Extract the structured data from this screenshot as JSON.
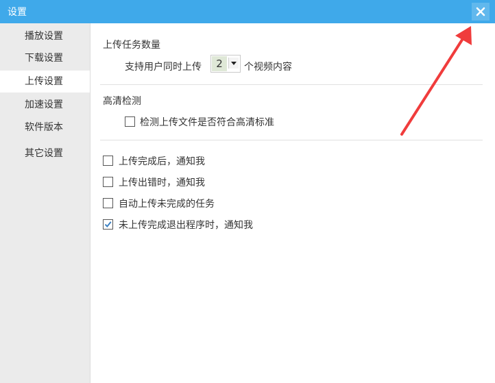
{
  "window": {
    "title": "设置",
    "close_icon": "close-icon"
  },
  "colors": {
    "titlebar": "#3fa9ea",
    "select_highlight": "#dfe8d7"
  },
  "sidebar": {
    "items": [
      {
        "label": "播放设置",
        "active": false
      },
      {
        "label": "下载设置",
        "active": false
      },
      {
        "label": "上传设置",
        "active": true
      },
      {
        "label": "加速设置",
        "active": false
      },
      {
        "label": "软件版本",
        "active": false
      },
      {
        "label": "其它设置",
        "active": false
      }
    ]
  },
  "upload_count": {
    "title": "上传任务数量",
    "prefix": "支持用户同时上传",
    "value": "2",
    "suffix": "个视频内容"
  },
  "hd_check": {
    "title": "高清检测",
    "option": {
      "label": "检测上传文件是否符合高清标准",
      "checked": false
    }
  },
  "notifications": [
    {
      "label": "上传完成后，通知我",
      "checked": false
    },
    {
      "label": "上传出错时，通知我",
      "checked": false
    },
    {
      "label": "自动上传未完成的任务",
      "checked": false
    },
    {
      "label": "未上传完成退出程序时，通知我",
      "checked": true
    }
  ]
}
